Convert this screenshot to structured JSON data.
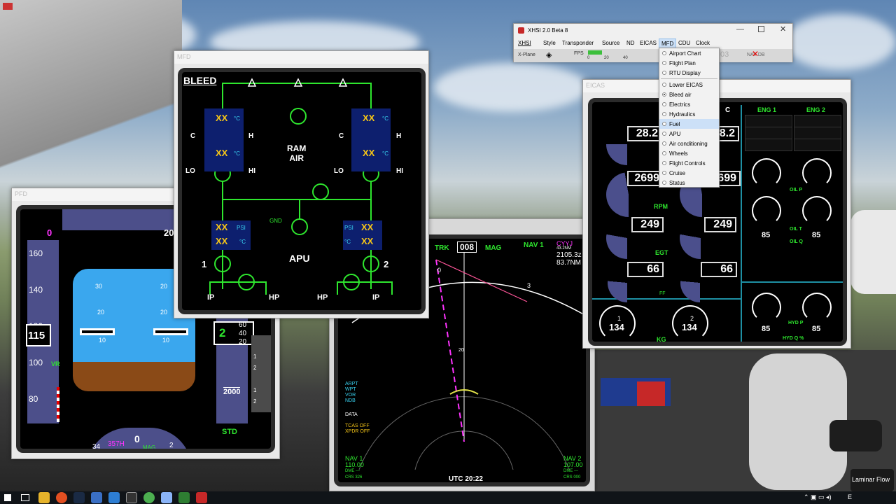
{
  "xhsi": {
    "title": "XHSI 2.0 Beta 8",
    "menu": [
      "XHSI",
      "Style",
      "Transponder",
      "Source",
      "ND",
      "EICAS",
      "MFD",
      "CDU",
      "Clock"
    ],
    "status_source": "X-Plane",
    "status_fps_label": "FPS",
    "fps_ticks": [
      "0",
      "20",
      "40"
    ],
    "status_partial": "03",
    "status_nav": "NAV DB",
    "dropdown": [
      {
        "label": "Airport Chart",
        "selected": false
      },
      {
        "label": "Flight Plan",
        "selected": false
      },
      {
        "label": "RTU Display",
        "selected": false
      },
      {
        "label": "Lower EICAS",
        "selected": false
      },
      {
        "label": "Bleed air",
        "selected": true
      },
      {
        "label": "Electrics",
        "selected": false
      },
      {
        "label": "Hydraulics",
        "selected": false
      },
      {
        "label": "Fuel",
        "selected": false
      },
      {
        "label": "APU",
        "selected": false
      },
      {
        "label": "Air conditioning",
        "selected": false
      },
      {
        "label": "Wheels",
        "selected": false
      },
      {
        "label": "Flight Controls",
        "selected": false
      },
      {
        "label": "Cruise",
        "selected": false
      },
      {
        "label": "Status",
        "selected": false
      }
    ]
  },
  "mfd": {
    "title": "MFD",
    "page": "BLEED",
    "ram_air": [
      "RAM",
      "AIR"
    ],
    "apu": "APU",
    "gnd": "GND",
    "xx": "XX",
    "deg_c": "°C",
    "psi": "PSI",
    "c": "C",
    "h": "H",
    "lo": "LO",
    "hi": "HI",
    "eng1": "1",
    "eng2": "2",
    "ip": "IP",
    "hp": "HP"
  },
  "eicas": {
    "title": "EICAS",
    "n1_left": "28.2",
    "n1_right": "28.2",
    "rpm_left": "2699",
    "rpm_right": "2699",
    "rpm_label": "RPM",
    "egt_left": "249",
    "egt_right": "249",
    "egt_label": "EGT",
    "ff_left": "66",
    "ff_right": "66",
    "ff_label": "FF",
    "fuel_left": "134",
    "fuel_right": "134",
    "fuel_unit": "KG",
    "fuel_idx": [
      "1",
      "2"
    ],
    "eng1": "ENG 1",
    "eng2": "ENG 2",
    "oil_p": "OIL P",
    "oil_t": "OIL T",
    "oil_q": "OIL Q",
    "oil_left": "85",
    "oil_right": "85",
    "hyd_p": "HYD P",
    "hyd_q": "HYD Q %",
    "hyd_left": "85",
    "hyd_right": "85",
    "c_label": "C"
  },
  "pfd": {
    "title": "PFD",
    "speed_ticks": [
      "160",
      "140",
      "120",
      "100",
      "80"
    ],
    "speed_top": "0",
    "speed_cur": "115",
    "speed_cur_small": "6",
    "vr": "VR",
    "alt_cur": "2",
    "alt_small": [
      "60",
      "40",
      "20"
    ],
    "alt_ticks": [
      "2000"
    ],
    "alt_top": "20",
    "vsi": [
      "1",
      "2",
      "1",
      "2",
      "6"
    ],
    "pitch": [
      "30",
      "20",
      "10",
      "10",
      "20",
      "30"
    ],
    "std": "STD",
    "hdg": "0",
    "hdg_label": "357H",
    "mag": "MAG",
    "hdg_ticks": [
      "34",
      "33",
      "1",
      "2"
    ]
  },
  "nd": {
    "trk": "TRK",
    "hdg": "008",
    "mag": "MAG",
    "nav1_top": "NAV 1",
    "station": "CYYJ",
    "dist_small": "43.2NM",
    "utc_eta": "2105.3z",
    "dist": "83.7NM",
    "scale": [
      "0",
      "3",
      "20"
    ],
    "arpt": [
      "ARPT",
      "WPT",
      "VOR",
      "NDB"
    ],
    "data": "DATA",
    "tcas": "TCAS OFF",
    "xpdr": "XPDR OFF",
    "nav1": "NAV 1",
    "nav1_freq": "110.00",
    "nav1_dme": "DME ---",
    "nav1_crs": "CRS 326",
    "nav2": "NAV 2",
    "nav2_freq": "107.00",
    "nav2_dme": "DME ---",
    "nav2_crs": "CRS 000",
    "utc": "UTC 20:22"
  },
  "laminar": "Laminar Flow",
  "taskbar": {
    "lang": "E"
  }
}
